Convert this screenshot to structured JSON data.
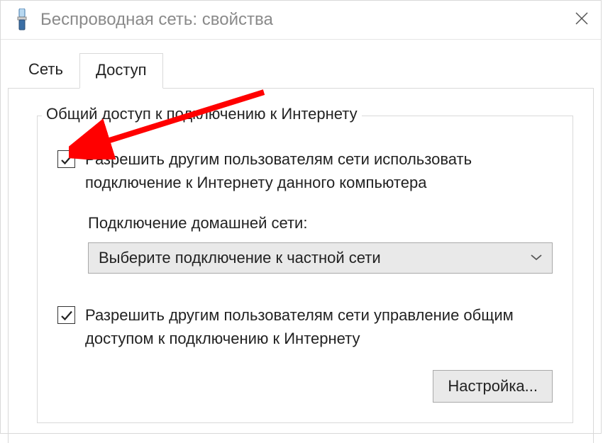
{
  "window": {
    "title": "Беспроводная сеть: свойства"
  },
  "tabs": {
    "network": "Сеть",
    "access": "Доступ"
  },
  "group": {
    "legend": "Общий доступ к подключению к Интернету",
    "allow_share_label": "Разрешить другим пользователям сети использовать подключение к Интернету данного компьютера",
    "home_connection_label": "Подключение домашней сети:",
    "dropdown_selected": "Выберите подключение к частной сети",
    "allow_control_label": "Разрешить другим пользователям сети управление общим доступом к подключению к Интернету",
    "settings_button": "Настройка..."
  }
}
